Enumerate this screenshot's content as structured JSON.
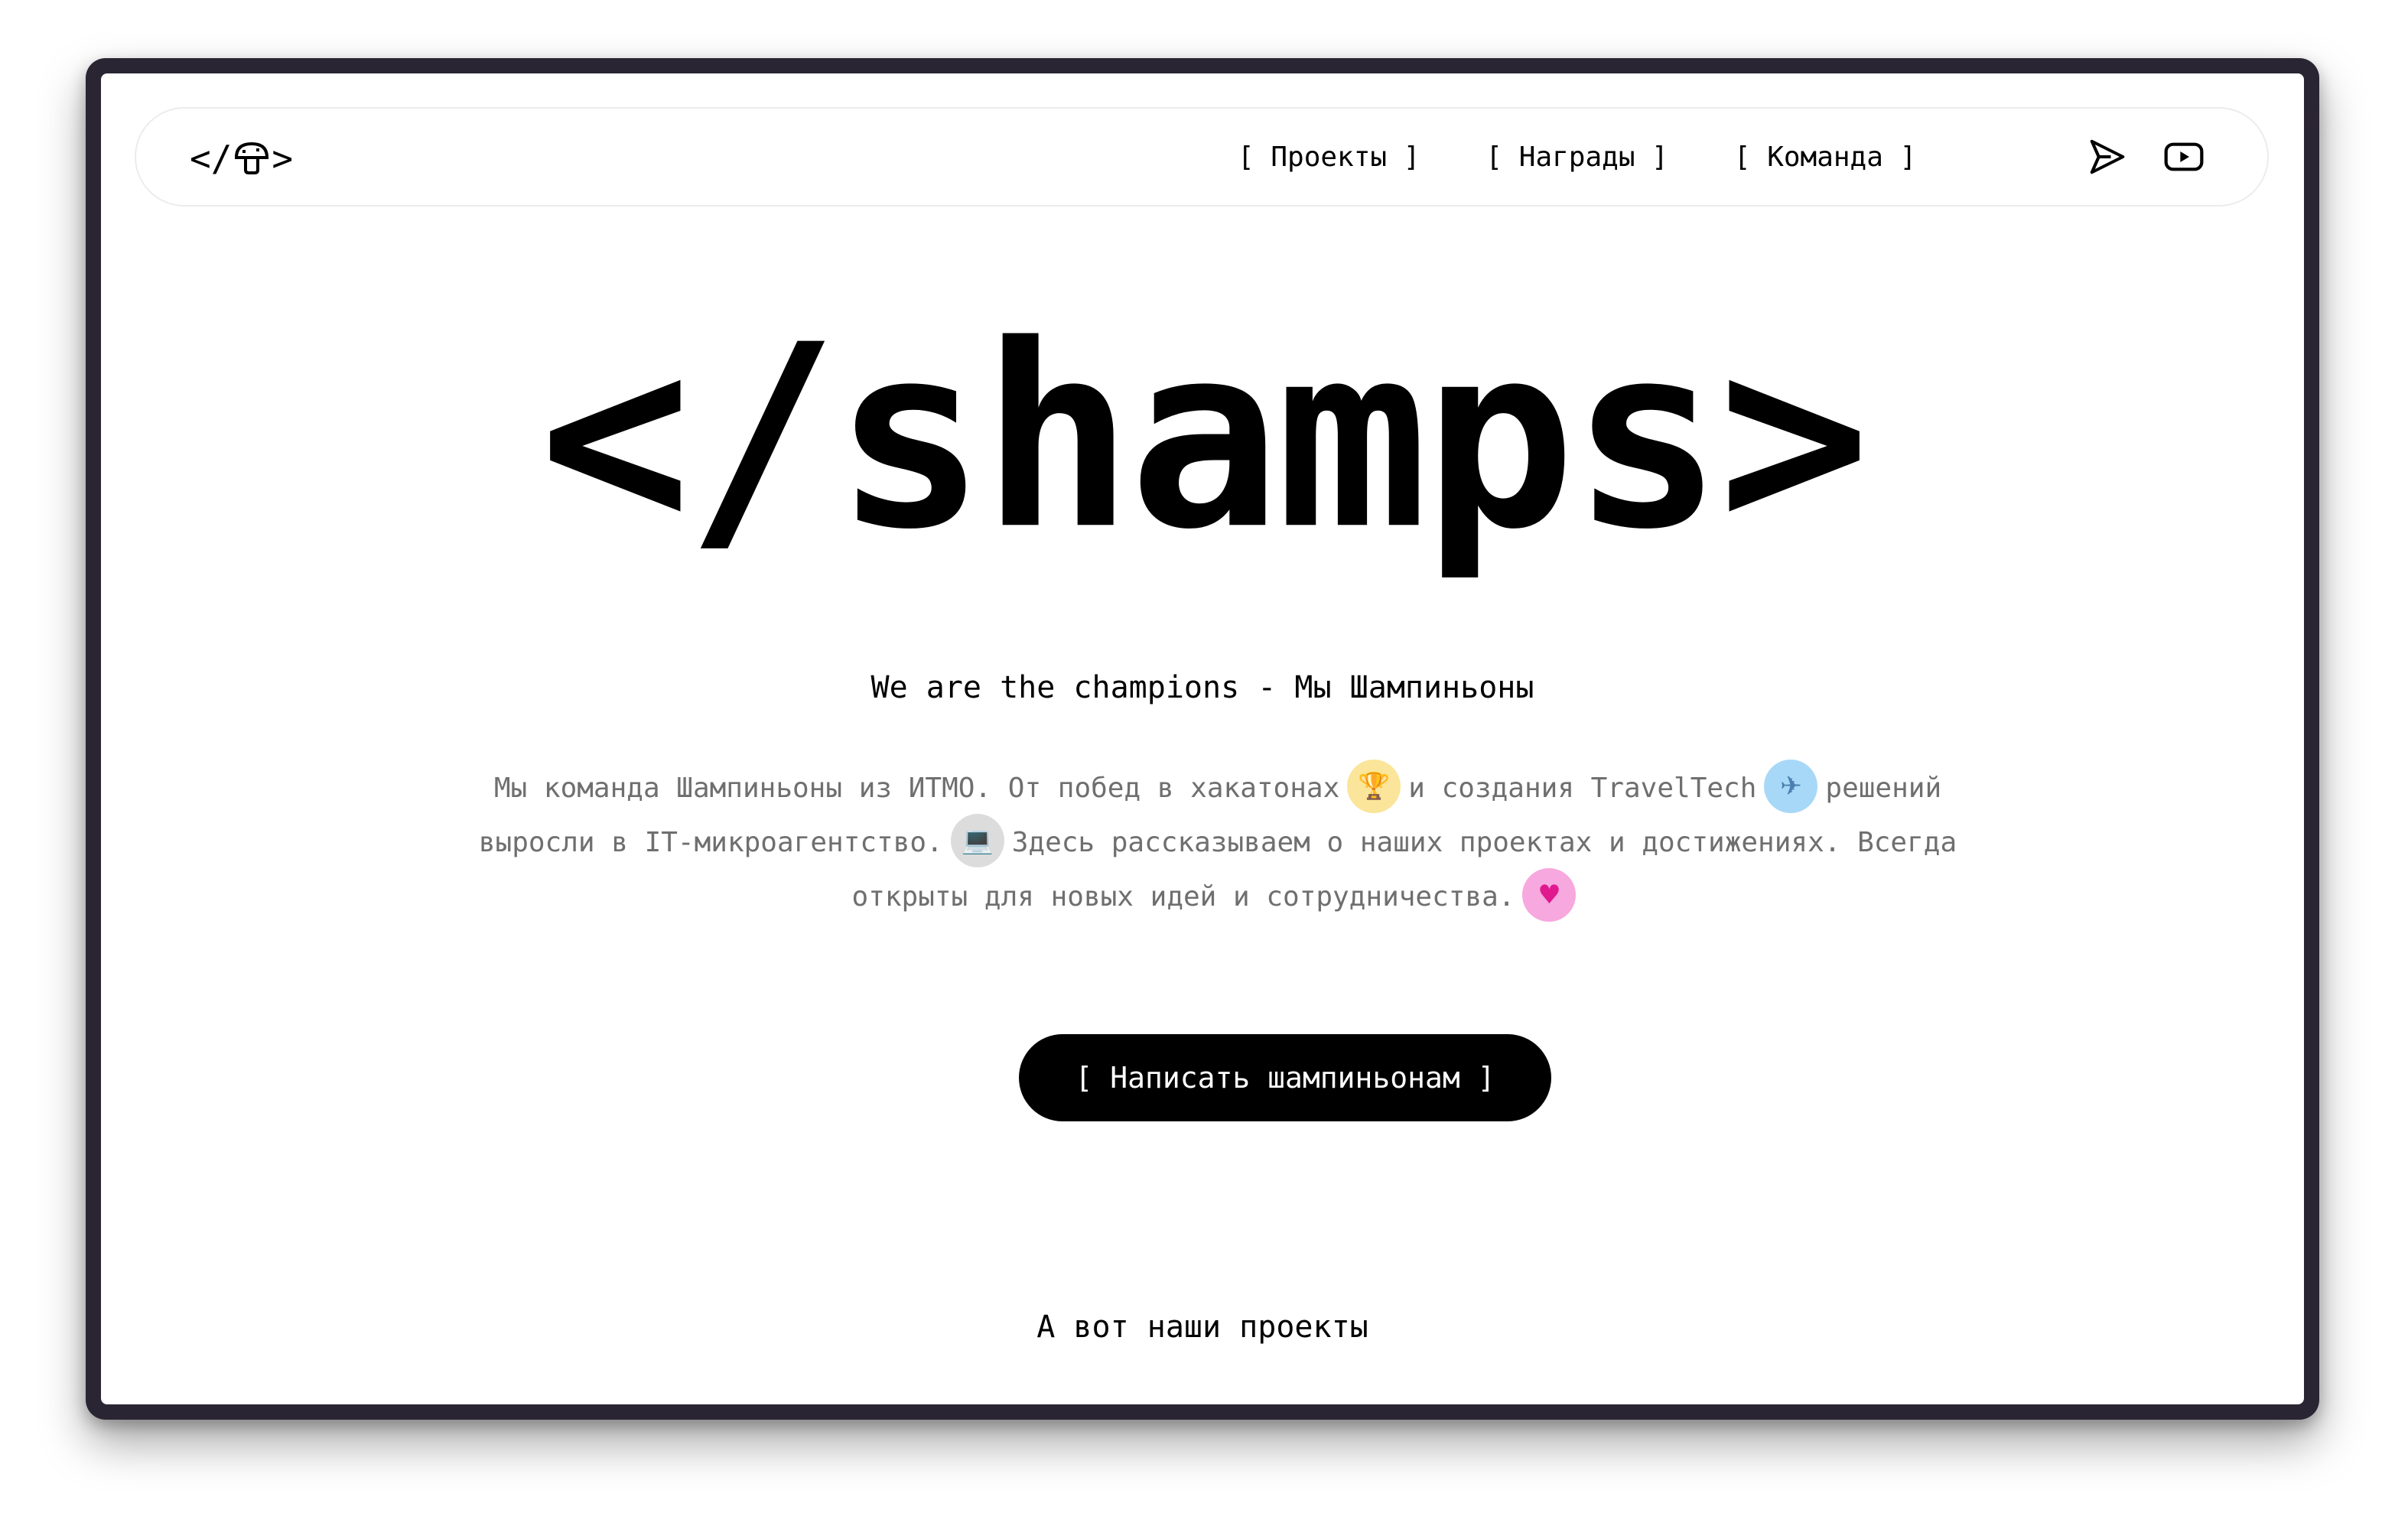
{
  "header": {
    "logo_text": "</  >",
    "logo_left": "</",
    "logo_right": ">",
    "nav": [
      {
        "label": "[ Проекты ]"
      },
      {
        "label": "[ Награды ]"
      },
      {
        "label": "[ Команда ]"
      }
    ],
    "icons": [
      "send-icon",
      "youtube-icon"
    ]
  },
  "hero": {
    "title": "</shamps>",
    "tagline": "We are the champions - Мы Шампиньоны",
    "description": {
      "part1": "Мы команда Шампиньоны из ИТМО. От побед в хакатонах",
      "emoji1": "🏆",
      "part2": "и создания TravelTech",
      "emoji2": "✈",
      "part3": "решений выросли в IT-микроагентство.",
      "emoji3": "💻",
      "part4": "Здесь рассказываем о наших проектах и достижениях. Всегда открыты для новых идей и сотрудничества.",
      "emoji4": "♥"
    },
    "cta_label": "[ Написать шампиньонам ]"
  },
  "projects": {
    "section_title": "А вот наши проекты"
  },
  "colors": {
    "frame": "#2a2532",
    "text": "#000000",
    "muted_text": "#6f6f6f",
    "cta_bg": "#000000",
    "cta_text": "#ffffff"
  }
}
